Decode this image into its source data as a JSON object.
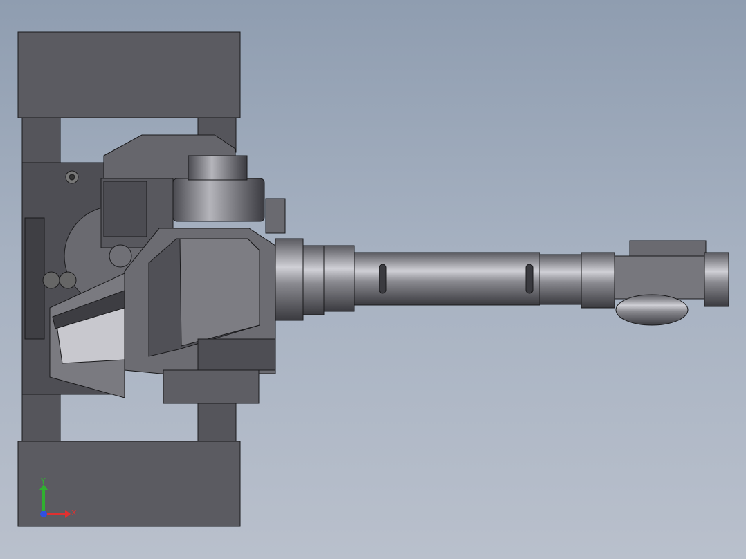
{
  "viewport": {
    "background_top": "#8f9db0",
    "background_bottom": "#b9c0cc"
  },
  "model": {
    "part_colors": {
      "dark": "#4a4a4f",
      "mid": "#6b6b72",
      "light": "#8c8c93",
      "highlight": "#c9c9cf",
      "edge": "#1a1a1c"
    }
  },
  "triad": {
    "x_label": "X",
    "y_label": "Y",
    "x_color": "#e03030",
    "y_color": "#30b030",
    "z_color": "#3050e0"
  }
}
